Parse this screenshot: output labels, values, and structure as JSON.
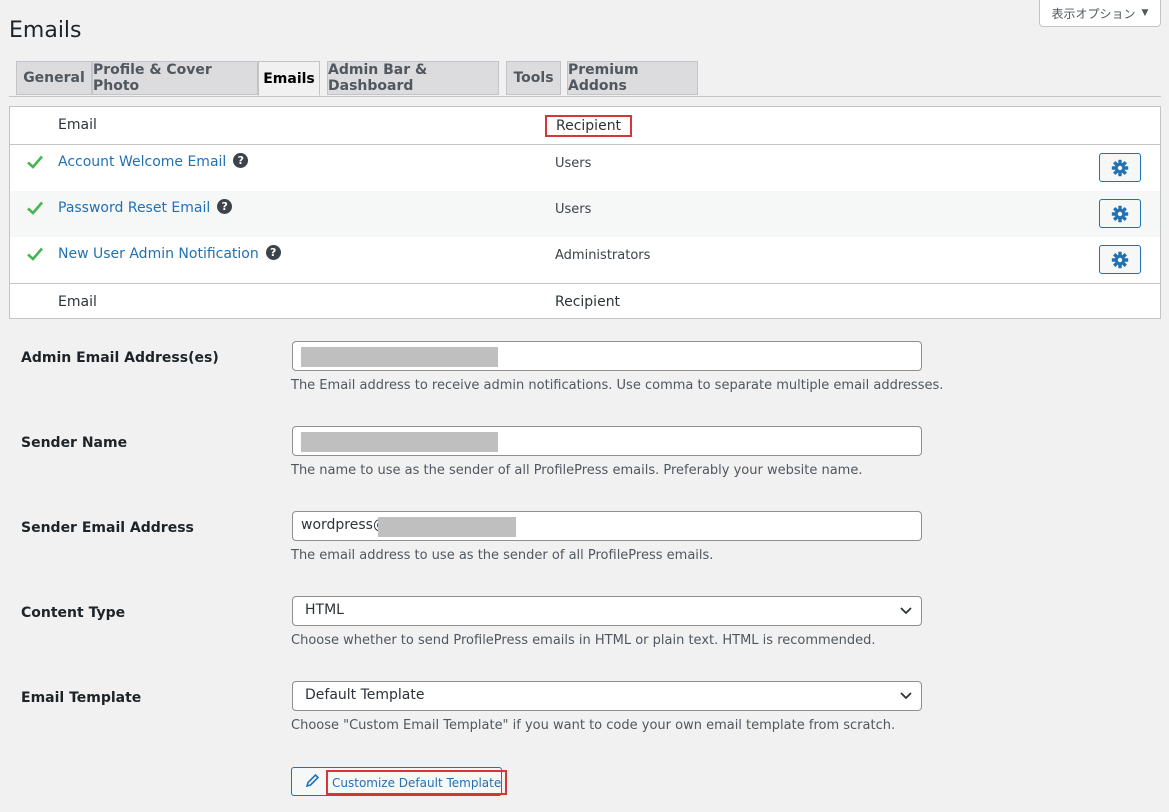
{
  "screen_options": {
    "label": "表示オプション",
    "icon": "caret-down-icon"
  },
  "page_title": "Emails",
  "tabs": [
    {
      "label": "General"
    },
    {
      "label": "Profile & Cover Photo"
    },
    {
      "label": "Emails",
      "active": true
    },
    {
      "label": "Admin Bar & Dashboard"
    },
    {
      "label": "Tools"
    },
    {
      "label": "Premium Addons"
    }
  ],
  "email_table": {
    "headers": {
      "email": "Email",
      "recipient": "Recipient"
    },
    "rows": [
      {
        "name": "Account Welcome Email",
        "recipient": "Users",
        "enabled": true
      },
      {
        "name": "Password Reset Email",
        "recipient": "Users",
        "enabled": true
      },
      {
        "name": "New User Admin Notification",
        "recipient": "Administrators",
        "enabled": true
      }
    ],
    "footers": {
      "email": "Email",
      "recipient": "Recipient"
    }
  },
  "settings": {
    "admin_email": {
      "label": "Admin Email Address(es)",
      "value": "",
      "description": "The Email address to receive admin notifications. Use comma to separate multiple email addresses."
    },
    "sender_name": {
      "label": "Sender Name",
      "value": "",
      "description": "The name to use as the sender of all ProfilePress emails. Preferably your website name."
    },
    "sender_email": {
      "label": "Sender Email Address",
      "value": "wordpress@",
      "description": "The email address to use as the sender of all ProfilePress emails."
    },
    "content_type": {
      "label": "Content Type",
      "value": "HTML",
      "description": "Choose whether to send ProfilePress emails in HTML or plain text. HTML is recommended."
    },
    "email_template": {
      "label": "Email Template",
      "value": "Default Template",
      "description": "Choose \"Custom Email Template\" if you want to code your own email template from scratch."
    }
  },
  "customize_button": {
    "label": "Customize Default Template"
  },
  "colors": {
    "accent": "#2271b1",
    "check": "#46b450",
    "highlight": "#d63638"
  }
}
